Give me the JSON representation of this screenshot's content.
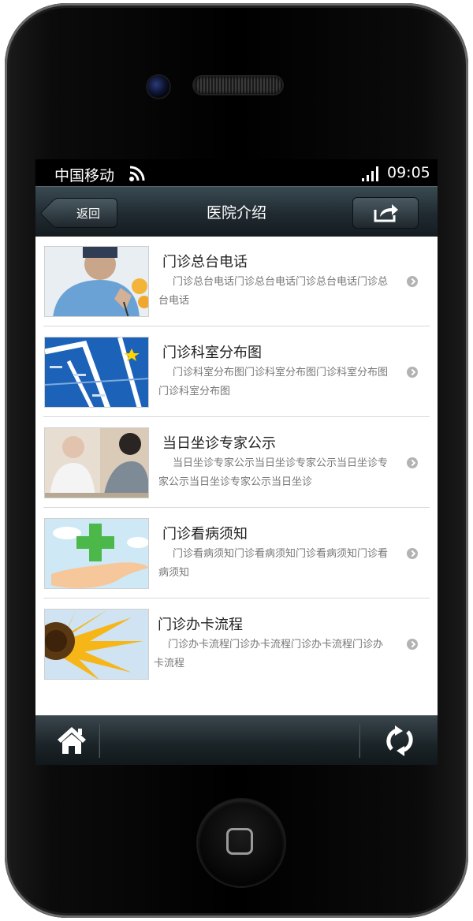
{
  "status_bar": {
    "carrier": "中国移动",
    "time": "09:05",
    "wifi_icon": "wifi-icon",
    "signal_icon": "signal-bars-icon"
  },
  "nav_bar": {
    "back_label": "返回",
    "title": "医院介绍",
    "share_icon": "share-icon"
  },
  "list": {
    "items": [
      {
        "title": "门诊总台电话",
        "desc": "门诊总台电话门诊总台电话门诊总台电话门诊总台电话",
        "image": "doctor-on-phone-photo"
      },
      {
        "title": "门诊科室分布图",
        "desc": "门诊科室分布图门诊科室分布图门诊科室分布图门诊科室分布图",
        "image": "department-map-image"
      },
      {
        "title": "当日坐诊专家公示",
        "desc": "当日坐诊专家公示当日坐诊专家公示当日坐诊专家公示当日坐诊专家公示当日坐诊",
        "image": "doctor-consultation-photo"
      },
      {
        "title": "门诊看病须知",
        "desc": "门诊看病须知门诊看病须知门诊看病须知门诊看病须知",
        "image": "medical-cross-hand-image"
      },
      {
        "title": "门诊办卡流程",
        "desc": "门诊办卡流程门诊办卡流程门诊办卡流程门诊办卡流程",
        "image": "sunflower-photo"
      }
    ]
  },
  "tab_bar": {
    "home_icon": "home-icon",
    "refresh_icon": "refresh-icon"
  },
  "colors": {
    "nav_bg": "#1f2a30",
    "status_bg": "#000000",
    "title_text": "#222222",
    "desc_text": "#777777",
    "divider": "#d8d8d8"
  }
}
